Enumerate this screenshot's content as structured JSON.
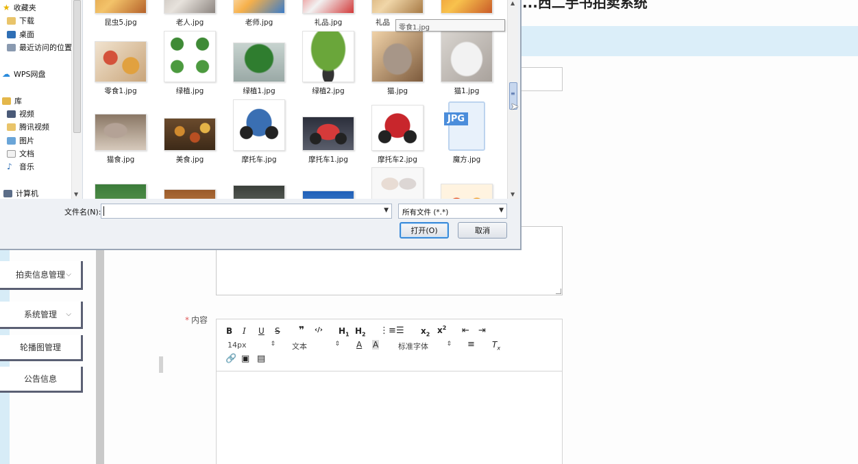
{
  "app": {
    "title": "...西二手书拍卖系统"
  },
  "sidebar": {
    "items": [
      {
        "label": "拍卖信息管理",
        "has_dropdown": true
      },
      {
        "label": "系统管理",
        "has_dropdown": true
      },
      {
        "label": "轮播图管理",
        "has_dropdown": false
      },
      {
        "label": "公告信息",
        "has_dropdown": false
      }
    ]
  },
  "form": {
    "content_label": "内容",
    "required_mark": "*"
  },
  "editor": {
    "font_size": "14px",
    "text_style": "文本",
    "font_family": "标准字体"
  },
  "dialog": {
    "nav": [
      {
        "label": "收藏夹",
        "icon": "star-icon"
      },
      {
        "label": "下载",
        "icon": "download-folder-icon"
      },
      {
        "label": "桌面",
        "icon": "desktop-icon"
      },
      {
        "label": "最近访问的位置",
        "icon": "recent-places-icon"
      },
      {
        "label": "WPS网盘",
        "icon": "cloud-icon"
      },
      {
        "label": "库",
        "icon": "library-icon"
      },
      {
        "label": "视频",
        "icon": "video-icon"
      },
      {
        "label": "腾讯视频",
        "icon": "folder-icon"
      },
      {
        "label": "图片",
        "icon": "picture-icon"
      },
      {
        "label": "文档",
        "icon": "document-icon"
      },
      {
        "label": "音乐",
        "icon": "music-icon"
      },
      {
        "label": "计算机",
        "icon": "computer-icon"
      }
    ],
    "files": [
      {
        "name": "昆虫5.jpg"
      },
      {
        "name": "老人.jpg"
      },
      {
        "name": "老师.jpg"
      },
      {
        "name": "礼品.jpg"
      },
      {
        "name": "礼品"
      },
      {
        "name": ""
      },
      {
        "name": "零食1.jpg"
      },
      {
        "name": "绿植.jpg"
      },
      {
        "name": "绿植1.jpg"
      },
      {
        "name": "绿植2.jpg"
      },
      {
        "name": "猫.jpg"
      },
      {
        "name": "猫1.jpg"
      },
      {
        "name": "猫食.jpg"
      },
      {
        "name": "美食.jpg"
      },
      {
        "name": "摩托车.jpg"
      },
      {
        "name": "摩托车1.jpg"
      },
      {
        "name": "摩托车2.jpg"
      },
      {
        "name": "魔方.jpg"
      },
      {
        "name": ""
      },
      {
        "name": ""
      },
      {
        "name": ""
      },
      {
        "name": ""
      },
      {
        "name": ""
      },
      {
        "name": ""
      }
    ],
    "tooltip": "零食1.jpg",
    "jpg_badge": "JPG",
    "filename_label": "文件名(N):",
    "filename_value": "",
    "filetype_value": "所有文件 (*.*)",
    "open_button": "打开(O)",
    "cancel_button": "取消"
  }
}
